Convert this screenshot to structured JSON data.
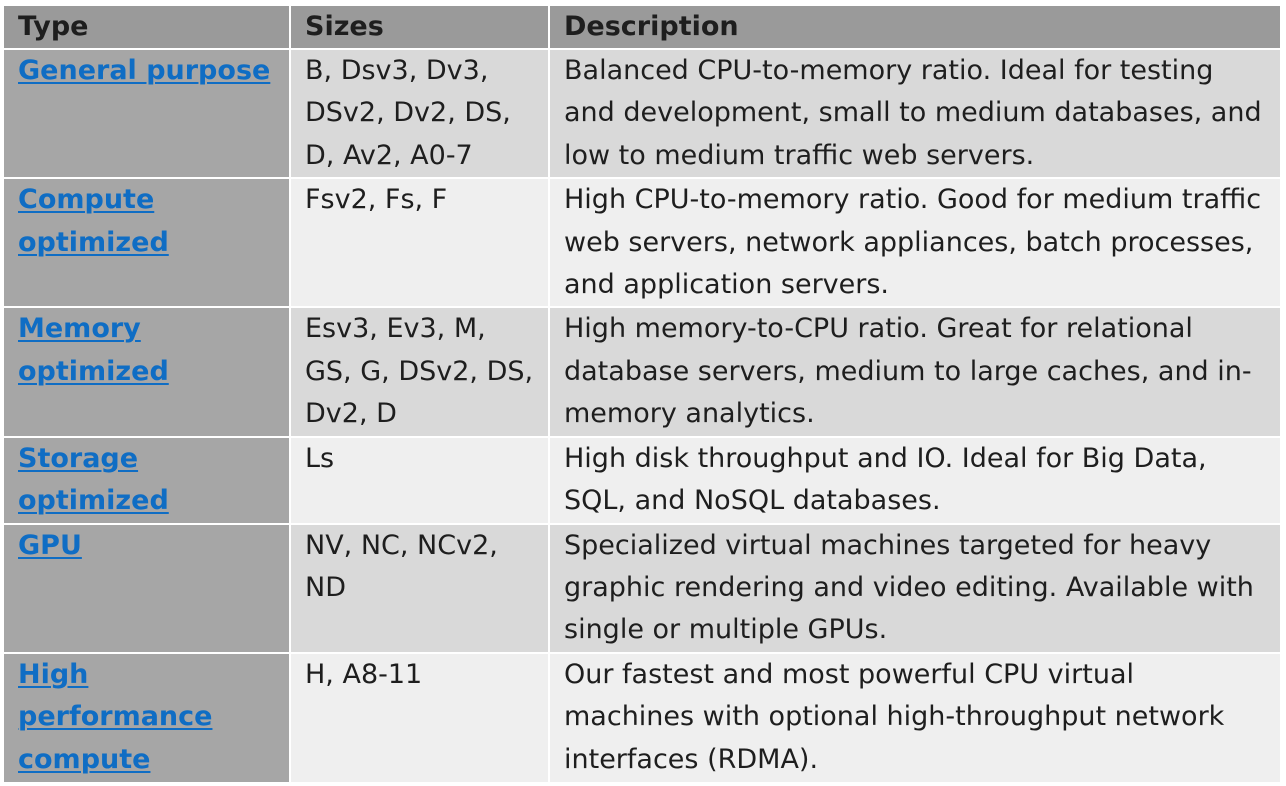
{
  "headers": [
    "Type",
    "Sizes",
    "Description"
  ],
  "rows": [
    {
      "type": "General purpose",
      "sizes": "B, Dsv3, Dv3, DSv2, Dv2, DS, D, Av2, A0-7",
      "description": "Balanced CPU-to-memory ratio. Ideal for testing and development, small to medium databases, and low to medium traffic web servers."
    },
    {
      "type": "Compute optimized",
      "sizes": "Fsv2, Fs, F",
      "description": "High CPU-to-memory ratio. Good for medium traffic web servers, network appliances, batch processes, and application servers."
    },
    {
      "type": "Memory optimized",
      "sizes": "Esv3, Ev3, M, GS, G, DSv2, DS, Dv2, D",
      "description": "High memory-to-CPU ratio. Great for relational database servers, medium to large caches, and in-memory analytics."
    },
    {
      "type": "Storage optimized",
      "sizes": "Ls",
      "description": "High disk throughput and IO. Ideal for Big Data, SQL, and NoSQL databases."
    },
    {
      "type": "GPU",
      "sizes": "NV, NC, NCv2, ND",
      "description": "Specialized virtual machines targeted for heavy graphic rendering and video editing. Available with single or multiple GPUs."
    },
    {
      "type": "High performance compute",
      "sizes": "H, A8-11",
      "description": "Our fastest and most powerful CPU virtual machines with optional high-throughput network interfaces (RDMA)."
    }
  ]
}
